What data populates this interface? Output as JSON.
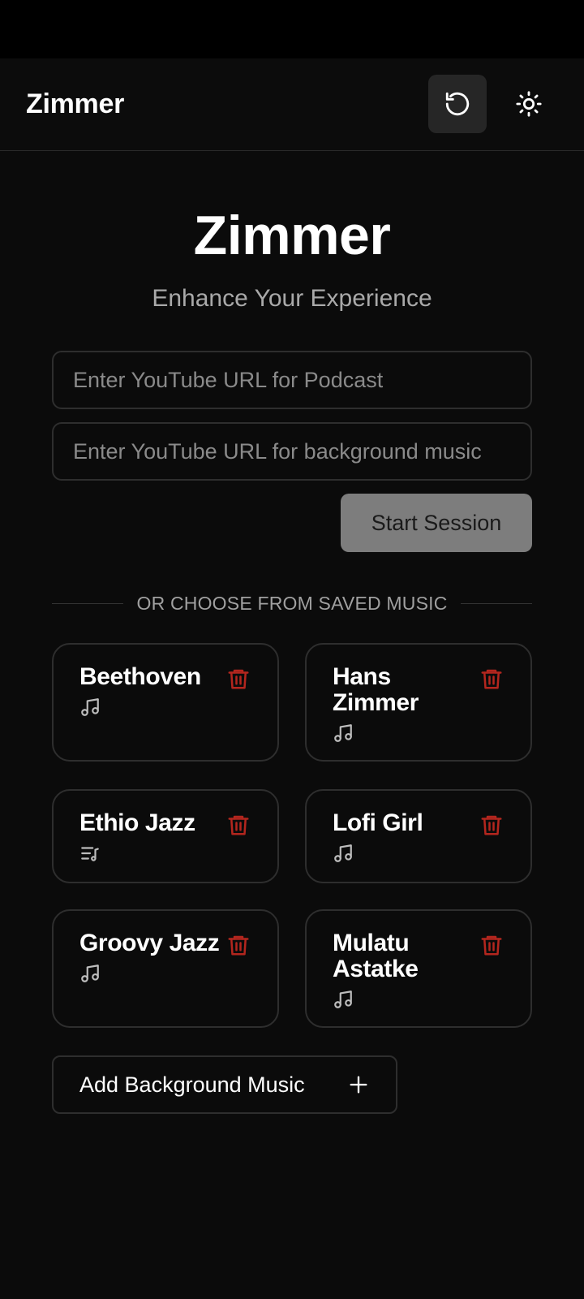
{
  "header": {
    "title": "Zimmer",
    "reset_icon": "rotate-ccw-icon",
    "theme_icon": "sun-icon"
  },
  "hero": {
    "title": "Zimmer",
    "subtitle": "Enhance Your Experience"
  },
  "form": {
    "podcast_placeholder": "Enter YouTube URL for Podcast",
    "podcast_value": "",
    "music_placeholder": "Enter YouTube URL for background music",
    "music_value": "",
    "start_label": "Start Session"
  },
  "divider": {
    "text": "OR CHOOSE FROM SAVED MUSIC"
  },
  "saved_music": [
    {
      "name": "Beethoven",
      "icon": "music-note-icon"
    },
    {
      "name": "Hans Zimmer",
      "icon": "music-note-icon"
    },
    {
      "name": "Ethio Jazz",
      "icon": "playlist-icon"
    },
    {
      "name": "Lofi Girl",
      "icon": "music-note-icon"
    },
    {
      "name": "Groovy Jazz",
      "icon": "music-note-icon"
    },
    {
      "name": "Mulatu Astatke",
      "icon": "music-note-icon"
    }
  ],
  "add_music": {
    "label": "Add Background Music",
    "icon": "plus-icon"
  },
  "colors": {
    "background": "#0b0b0b",
    "delete_red": "#b3261e",
    "start_button": "#7d7d7d"
  }
}
